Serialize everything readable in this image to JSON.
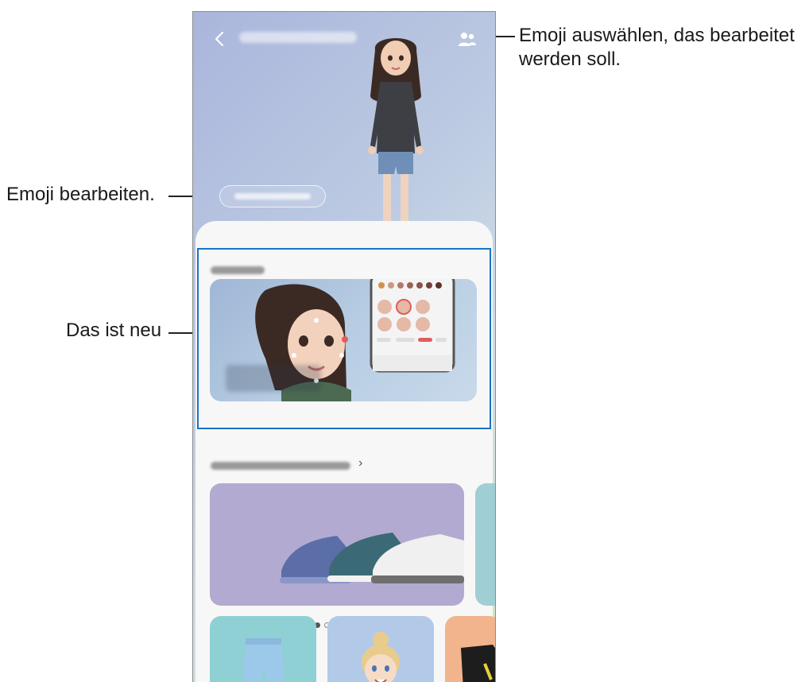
{
  "callouts": {
    "select_emoji": "Emoji auswählen, das bearbeitet werden soll.",
    "select_emoji_line1": "Emoji auswählen, das bearbeitet",
    "select_emoji_line2": "werden soll.",
    "edit_emoji": "Emoji bearbeiten.",
    "whats_new": "Das ist neu"
  },
  "icons": {
    "back": "chevron-left-icon",
    "people": "people-icon"
  },
  "colors": {
    "highlight_border": "#1a73c7",
    "header_gradient_start": "#aab5dc",
    "header_gradient_end": "#d4e6c0"
  },
  "carousel": {
    "page_count": 6,
    "active_index": 0
  }
}
